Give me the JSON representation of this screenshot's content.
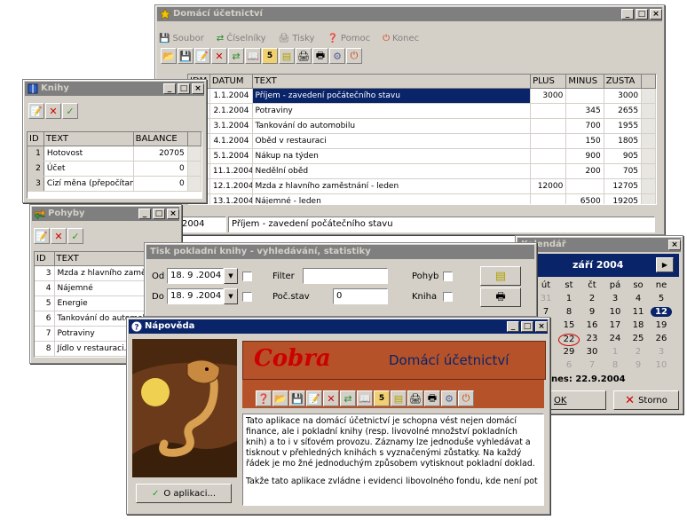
{
  "main": {
    "title": "Domácí účetnictví",
    "menu": [
      {
        "label": "Soubor",
        "icon": "save-icon"
      },
      {
        "label": "Číselníky",
        "icon": "exchange-icon"
      },
      {
        "label": "Tisky",
        "icon": "print-icon"
      },
      {
        "label": "Pomoc",
        "icon": "help-icon"
      },
      {
        "label": "Konec",
        "icon": "power-icon"
      }
    ],
    "columns": [
      "IDM",
      "DATUM",
      "TEXT",
      "PLUS",
      "MINUS",
      "ZUSTA"
    ],
    "rows": [
      {
        "idm": "1",
        "date": "1.1.2004",
        "text": "Příjem - zavedení počátečního stavu",
        "plus": "3000",
        "minus": "",
        "rest": "3000"
      },
      {
        "idm": "2",
        "date": "2.1.2004",
        "text": "Potraviny",
        "plus": "",
        "minus": "345",
        "rest": "2655"
      },
      {
        "idm": "6",
        "date": "3.1.2004",
        "text": "Tankování do automobilu",
        "plus": "",
        "minus": "700",
        "rest": "1955"
      },
      {
        "idm": "8",
        "date": "4.1.2004",
        "text": "Oběd v restauraci",
        "plus": "",
        "minus": "150",
        "rest": "1805"
      },
      {
        "idm": "7",
        "date": "5.1.2004",
        "text": "Nákup na týden",
        "plus": "",
        "minus": "900",
        "rest": "905"
      },
      {
        "idm": "8",
        "date": "11.1.2004",
        "text": "Nedělní oběd",
        "plus": "",
        "minus": "200",
        "rest": "705"
      },
      {
        "idm": "3",
        "date": "12.1.2004",
        "text": "Mzda z hlavního zaměstnání - leden",
        "plus": "12000",
        "minus": "",
        "rest": "12705"
      },
      {
        "idm": "4",
        "date": "13.1.2004",
        "text": "Nájemné - leden",
        "plus": "",
        "minus": "6500",
        "rest": "19205"
      }
    ],
    "detail_date": "2004",
    "detail_text": "Příjem - zavedení počátečního stavu"
  },
  "knihy": {
    "title": "Knihy",
    "columns": [
      "ID",
      "TEXT",
      "BALANCE"
    ],
    "rows": [
      {
        "id": "1",
        "text": "Hotovost",
        "balance": "20705"
      },
      {
        "id": "2",
        "text": "Účet",
        "balance": "0"
      },
      {
        "id": "3",
        "text": "Cizí měna (přepočítaná",
        "balance": "0"
      }
    ]
  },
  "pohyby": {
    "title": "Pohyby",
    "columns": [
      "ID",
      "TEXT"
    ],
    "rows": [
      {
        "id": "3",
        "text": "Mzda z hlavního zaměs"
      },
      {
        "id": "4",
        "text": "Nájemné"
      },
      {
        "id": "5",
        "text": "Energie"
      },
      {
        "id": "6",
        "text": "Tankování do automobi"
      },
      {
        "id": "7",
        "text": "Potraviny"
      },
      {
        "id": "8",
        "text": "Jídlo v restauraci."
      }
    ]
  },
  "tisk": {
    "title": "Tisk pokladní knihy - vyhledávání, statistiky",
    "od_label": "Od",
    "od_value": "18. 9 .2004",
    "do_label": "Do",
    "do_value": "18. 9 .2004",
    "filter_label": "Filter",
    "filter_value": "",
    "pocstav_label": "Poč.stav",
    "pocstav_value": "0",
    "pohyb_label": "Pohyb",
    "kniha_label": "Kniha"
  },
  "kalendar": {
    "title": "Kalendář",
    "month": "září 2004",
    "day_headers": [
      "út",
      "st",
      "čt",
      "pá",
      "so",
      "ne"
    ],
    "weeks": [
      [
        "31",
        "1",
        "2",
        "3",
        "4",
        "5"
      ],
      [
        "7",
        "8",
        "9",
        "10",
        "11",
        "12"
      ],
      [
        "14",
        "15",
        "16",
        "17",
        "18",
        "19"
      ],
      [
        "21",
        "22",
        "23",
        "24",
        "25",
        "26"
      ],
      [
        "28",
        "29",
        "30",
        "1",
        "2",
        "3"
      ],
      [
        "5",
        "6",
        "7",
        "8",
        "9",
        "10"
      ]
    ],
    "today_label": "nes: 22.9.2004",
    "ok_label": "OK",
    "storno_label": "Storno"
  },
  "napoveda": {
    "title": "Nápověda",
    "logo": "Cobra",
    "heading": "Domácí účetnictví",
    "paragraph1": "Tato aplikace na domácí účetnictví je schopna vést nejen domácí finance, ale i pokladní knihy (resp. livovolné množství pokladních knih) a to i v síťovém provozu. Záznamy lze jednoduše vyhledávat a tisknout v přehledných knihách s vyznačenými zůstatky. Na každý řádek je mo žné jednoduchým způsobem vytisknout pokladní doklad.",
    "paragraph2": "Takže tato aplikace zvládne i evidenci libovolného fondu, kde není pot",
    "about_button": "O aplikaci..."
  },
  "colors": {
    "active_title": "#0a246a",
    "inactive_title": "#7f7f7f",
    "face": "#d4d0c8",
    "help_panel": "#b5522a",
    "logo_red": "#cc0000"
  }
}
